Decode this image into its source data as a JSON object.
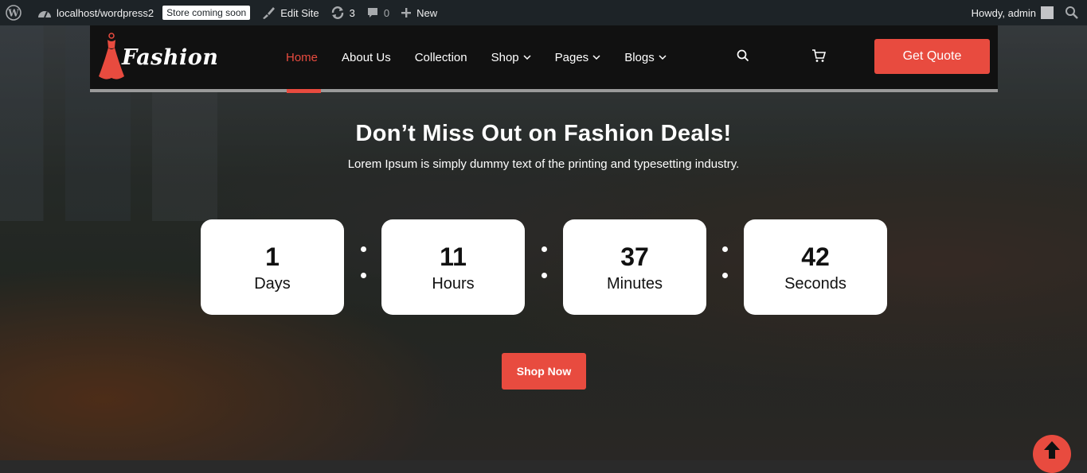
{
  "adminbar": {
    "site": "localhost/wordpress2",
    "store_badge": "Store coming soon",
    "edit_site": "Edit Site",
    "updates_count": "3",
    "comments_count": "0",
    "new_label": "New",
    "howdy": "Howdy, admin"
  },
  "header": {
    "logo_text": "Fashion",
    "nav": [
      {
        "label": "Home",
        "active": true
      },
      {
        "label": "About Us"
      },
      {
        "label": "Collection"
      },
      {
        "label": "Shop",
        "dropdown": true
      },
      {
        "label": "Pages",
        "dropdown": true
      },
      {
        "label": "Blogs",
        "dropdown": true
      }
    ],
    "quote_button": "Get Quote"
  },
  "hero": {
    "title": "Don’t Miss Out on Fashion Deals!",
    "subtitle": "Lorem Ipsum is simply dummy text of the printing and typesetting industry.",
    "countdown": [
      {
        "value": "1",
        "label": "Days"
      },
      {
        "value": "11",
        "label": "Hours"
      },
      {
        "value": "37",
        "label": "Minutes"
      },
      {
        "value": "42",
        "label": "Seconds"
      }
    ],
    "shop_button": "Shop Now"
  },
  "colors": {
    "accent": "#e84b3f",
    "header_bg": "#111111",
    "adminbar_bg": "#1d2327"
  }
}
